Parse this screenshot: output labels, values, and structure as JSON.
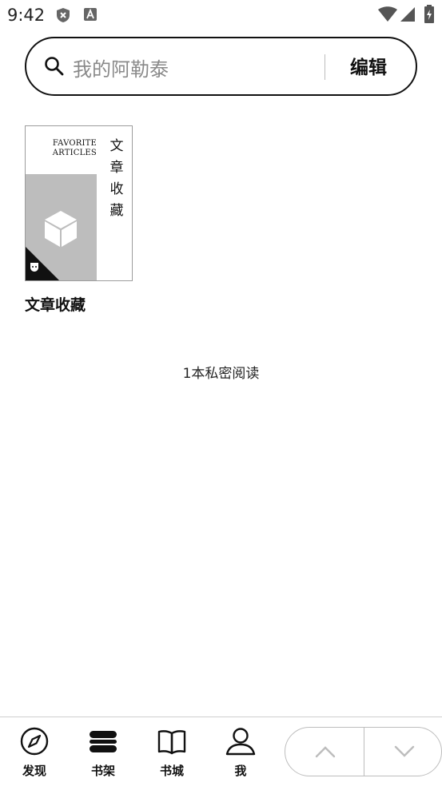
{
  "status_bar": {
    "time": "9:42",
    "icons": [
      "shield-x-icon",
      "font-a-icon",
      "wifi-icon",
      "signal-icon",
      "battery-charging-icon"
    ]
  },
  "search": {
    "placeholder": "我的阿勒泰",
    "edit_label": "编辑"
  },
  "shelf": {
    "books": [
      {
        "title": "文章收藏",
        "cover_en_line1": "FAVORITE",
        "cover_en_line2": "ARTICLES",
        "cover_cn": "文章收藏"
      }
    ],
    "count_text": "1本私密阅读"
  },
  "bottom_nav": {
    "items": [
      {
        "label": "发现",
        "icon": "compass-icon"
      },
      {
        "label": "书架",
        "icon": "bookshelf-icon"
      },
      {
        "label": "书城",
        "icon": "open-book-icon"
      },
      {
        "label": "我",
        "icon": "person-icon"
      }
    ],
    "pager": {
      "up_icon": "chevron-up-icon",
      "down_icon": "chevron-down-icon"
    }
  },
  "colors": {
    "text": "#111111",
    "placeholder": "#8a8a8a",
    "cover_gray": "#bdbdbd",
    "border": "#bdbdbd"
  }
}
